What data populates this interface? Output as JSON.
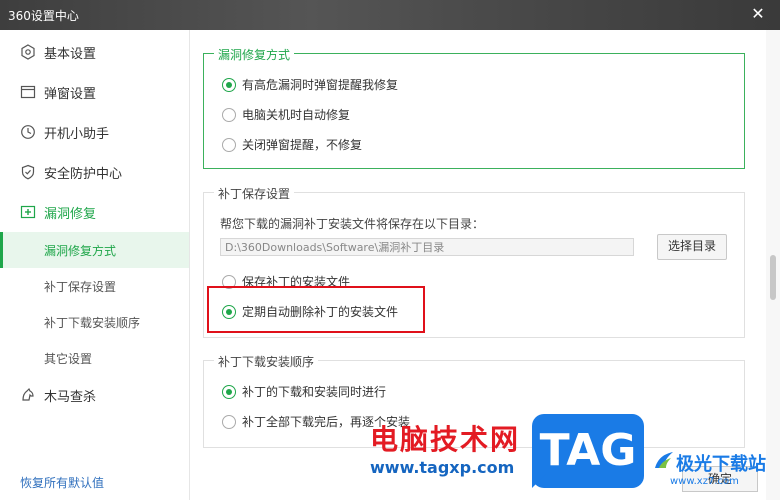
{
  "window": {
    "title": "360设置中心",
    "close_glyph": "✕"
  },
  "sidebar": {
    "items": [
      {
        "label": "基本设置",
        "icon": "hexagon-gear-icon"
      },
      {
        "label": "弹窗设置",
        "icon": "window-icon"
      },
      {
        "label": "开机小助手",
        "icon": "clock-icon"
      },
      {
        "label": "安全防护中心",
        "icon": "shield-icon"
      },
      {
        "label": "漏洞修复",
        "icon": "plus-square-icon"
      }
    ],
    "sub_items": [
      {
        "label": "漏洞修复方式",
        "selected": true
      },
      {
        "label": "补丁保存设置",
        "selected": false
      },
      {
        "label": "补丁下载安装顺序",
        "selected": false
      },
      {
        "label": "其它设置",
        "selected": false
      }
    ],
    "trojan": {
      "label": "木马查杀",
      "icon": "horse-icon"
    },
    "restore_defaults": "恢复所有默认值"
  },
  "repair_mode": {
    "title": "漏洞修复方式",
    "options": [
      {
        "label": "有高危漏洞时弹窗提醒我修复",
        "checked": true
      },
      {
        "label": "电脑关机时自动修复",
        "checked": false
      },
      {
        "label": "关闭弹窗提醒，不修复",
        "checked": false
      }
    ]
  },
  "patch_save": {
    "title": "补丁保存设置",
    "path_label": "帮您下载的漏洞补丁安装文件将保存在以下目录：",
    "path_value": "D:\\360Downloads\\Software\\漏洞补丁目录",
    "choose_dir": "选择目录",
    "options": [
      {
        "label": "保存补丁的安装文件",
        "checked": false
      },
      {
        "label": "定期自动删除补丁的安装文件",
        "checked": true
      }
    ]
  },
  "download_order": {
    "title": "补丁下载安装顺序",
    "options": [
      {
        "label": "补丁的下载和安装同时进行",
        "checked": true
      },
      {
        "label": "补丁全部下载完后，再逐个安装",
        "checked": false
      }
    ]
  },
  "footer": {
    "confirm": "确定"
  },
  "watermark": {
    "cn": "电脑技术网",
    "url": "www.tagxp.com",
    "tag": "TAG",
    "site": "极光下载站",
    "site_url": "www.xz7.com"
  },
  "colors": {
    "accent": "#1fa64a",
    "highlight": "#e0101a",
    "titlebar": "#4a4a4a"
  }
}
